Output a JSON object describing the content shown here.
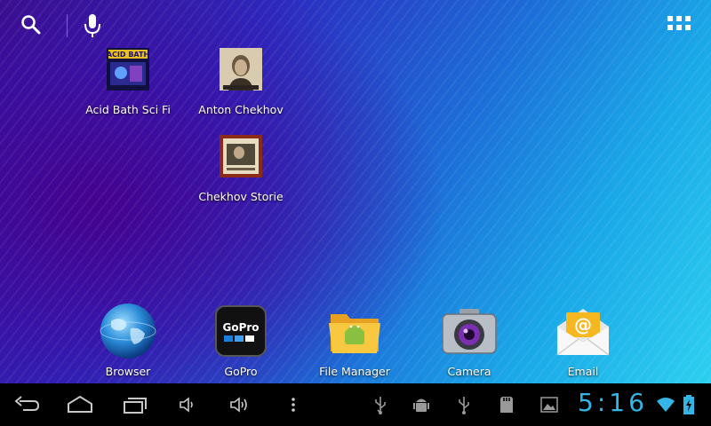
{
  "desktop": {
    "shortcuts": [
      {
        "label": "Acid Bath Sci Fi",
        "icon": "acid-bath-album-icon"
      },
      {
        "label": "Anton Chekhov",
        "icon": "anton-chekhov-portrait-icon"
      },
      {
        "label": "Chekhov Storie",
        "icon": "chekhov-stories-book-icon"
      }
    ]
  },
  "dock": {
    "items": [
      {
        "label": "Browser",
        "icon": "globe-icon"
      },
      {
        "label": "GoPro",
        "icon": "gopro-icon"
      },
      {
        "label": "File Manager",
        "icon": "folder-android-icon"
      },
      {
        "label": "Camera",
        "icon": "camera-icon"
      },
      {
        "label": "Email",
        "icon": "email-envelope-icon"
      }
    ]
  },
  "status_bar": {
    "time": "5:16",
    "clock_color": "#33b5e5",
    "icons": [
      "usb-icon",
      "android-debug-icon",
      "usb-icon",
      "sd-card-icon",
      "screenshot-image-icon",
      "wifi-icon",
      "battery-charging-icon"
    ]
  },
  "colors": {
    "accent": "#33b5e5",
    "navbar_bg": "#000000"
  }
}
